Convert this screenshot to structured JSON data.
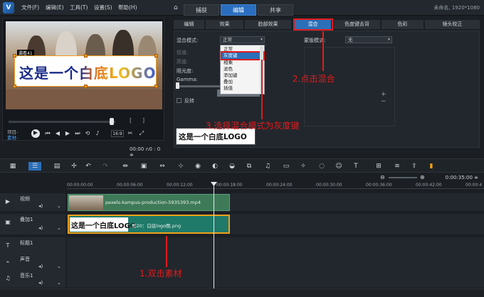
{
  "menu": [
    "文件(F)",
    "编辑(E)",
    "工具(T)",
    "设置(S)",
    "帮助(H)"
  ],
  "workspace_tabs": [
    "捕获",
    "编辑",
    "共享"
  ],
  "project_info": "未命名, 1920*1080",
  "preview": {
    "badge": "漏看41",
    "overlay_text": "这是一个白底LOGO",
    "mode_labels": [
      "项目-",
      "素材-"
    ],
    "timecode": "00:00 ∩0 : 0 ≑"
  },
  "options_tabs": [
    "编辑",
    "效果",
    "脸部效果",
    "混合",
    "色度键去背",
    "色彩",
    "镜头校正"
  ],
  "options": {
    "blend_mode_label": "混合模式:",
    "blend_mode_value": "正常",
    "mask_mode_label": "蒙版模式:",
    "mask_mode_value": "无",
    "dim_labels": [
      "低值:",
      "高值:"
    ],
    "opacity_label": "阻光度:",
    "gamma_label": "Gamma:",
    "reverse_label": "反转",
    "dropdown_options": [
      "正常",
      "灰度键",
      "相乘",
      "滤色",
      "添加键",
      "叠加",
      "插值"
    ],
    "preview_text": "这是一个白底LOGO"
  },
  "annotations": {
    "step1": "1.双击素材",
    "step2": "2.点击混合",
    "step3": "3.选择混合模式为灰度键"
  },
  "zoom_readout": "0:00:35:00 ≑",
  "ruler_ticks": [
    "00:00:00:00",
    "00:00:06:00",
    "00:00:12:00",
    "00:00:18:00",
    "00:00:24:00",
    "00:00:30:00",
    "00:00:36:00",
    "00:00:42:00",
    "00:00:4"
  ],
  "tracks": [
    {
      "name": "视频"
    },
    {
      "name": "叠加1"
    },
    {
      "name": "标题1"
    },
    {
      "name": "声音"
    },
    {
      "name": "音乐1"
    }
  ],
  "clips": {
    "video": "pexels-kampus-production-5935393.mp4",
    "overlay": "图20：白底logo图.png",
    "overlay_thumb_text": "这是一个白底LOGO"
  },
  "colors": {
    "accent": "#2b6fb8",
    "annotation": "#e21b1b",
    "clip_border": "#f0a018"
  }
}
